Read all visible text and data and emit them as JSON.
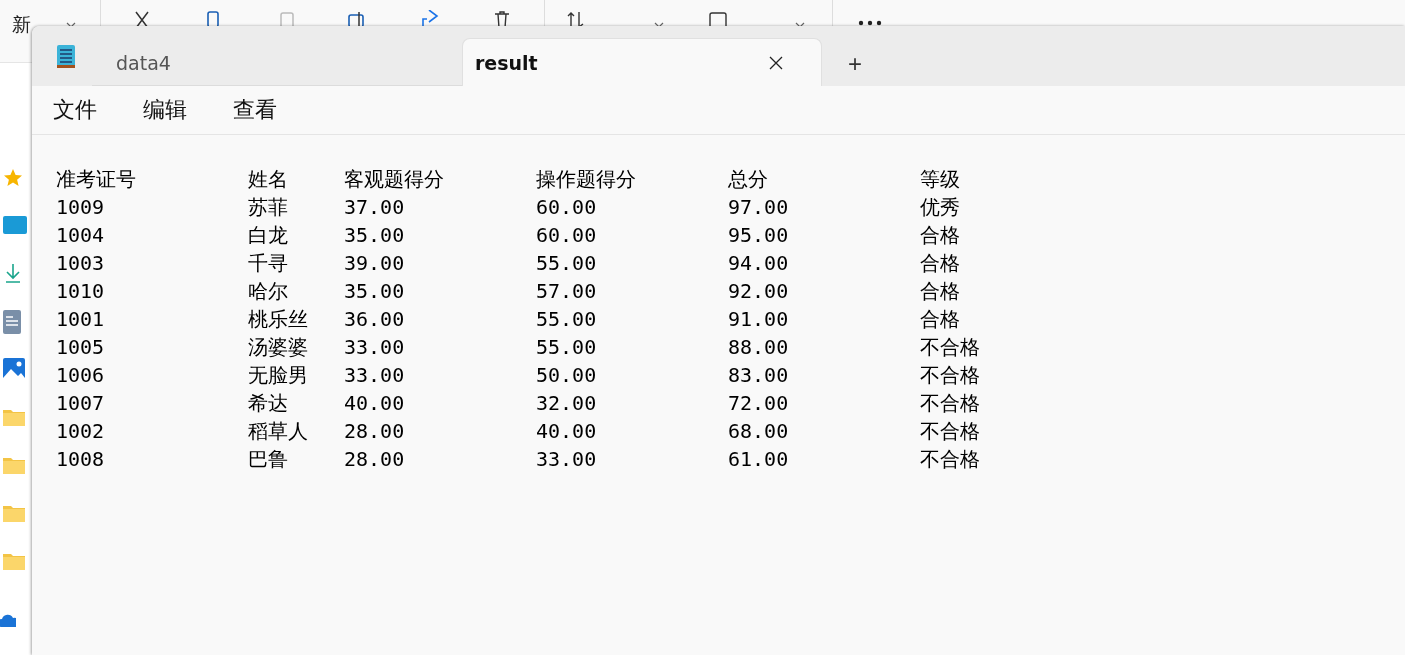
{
  "explorer": {
    "new_label": "新"
  },
  "notepad": {
    "tabs": [
      {
        "label": "data4",
        "selected": false
      },
      {
        "label": "result",
        "selected": true
      }
    ],
    "new_tab": "+",
    "menu": [
      "文件",
      "编辑",
      "查看"
    ],
    "lines": [
      [
        "准考证号",
        "姓名",
        "客观题得分",
        "操作题得分",
        "总分",
        "等级"
      ],
      [
        "1009",
        "苏菲",
        "37.00",
        "60.00",
        "97.00",
        "优秀"
      ],
      [
        "1004",
        "白龙",
        "35.00",
        "60.00",
        "95.00",
        "合格"
      ],
      [
        "1003",
        "千寻",
        "39.00",
        "55.00",
        "94.00",
        "合格"
      ],
      [
        "1010",
        "哈尔",
        "35.00",
        "57.00",
        "92.00",
        "合格"
      ],
      [
        "1001",
        "桃乐丝",
        "36.00",
        "55.00",
        "91.00",
        "合格"
      ],
      [
        "1005",
        "汤婆婆",
        "33.00",
        "55.00",
        "88.00",
        "不合格"
      ],
      [
        "1006",
        "无脸男",
        "33.00",
        "50.00",
        "83.00",
        "不合格"
      ],
      [
        "1007",
        "希达",
        "40.00",
        "32.00",
        "72.00",
        "不合格"
      ],
      [
        "1002",
        "稻草人",
        "28.00",
        "40.00",
        "68.00",
        "不合格"
      ],
      [
        "1008",
        "巴鲁",
        "28.00",
        "33.00",
        "61.00",
        "不合格"
      ]
    ]
  }
}
